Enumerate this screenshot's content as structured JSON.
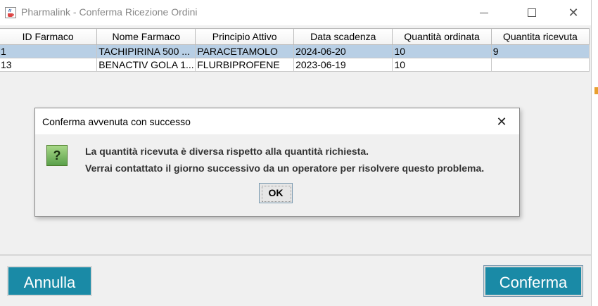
{
  "window": {
    "title": "Pharmalink - Conferma Ricezione Ordini",
    "minimize_glyph": "",
    "close_glyph": "✕"
  },
  "table": {
    "columns": [
      "ID Farmaco",
      "Nome Farmaco",
      "Principio Attivo",
      "Data scadenza",
      "Quantità ordinata",
      "Quantita ricevuta"
    ],
    "rows": [
      {
        "id": "1",
        "nome": "TACHIPIRINA 500 ...",
        "principio": "PARACETAMOLO",
        "scadenza": "2024-06-20",
        "ordinata": "10",
        "ricevuta": "9"
      },
      {
        "id": "13",
        "nome": "BENACTIV GOLA 1...",
        "principio": "FLURBIPROFENE",
        "scadenza": "2023-06-19",
        "ordinata": "10",
        "ricevuta": ""
      }
    ]
  },
  "dialog": {
    "title": "Conferma avvenuta con successo",
    "close_glyph": "✕",
    "icon_glyph": "?",
    "message_line1": "La quantità ricevuta è diversa rispetto alla quantità richiesta.",
    "message_line2": "Verrai contattato il giorno successivo da un operatore per risolvere questo problema.",
    "ok_label": "OK"
  },
  "buttons": {
    "annulla_label": "Annulla",
    "conferma_label": "Conferma"
  },
  "colors": {
    "accent_button": "#1a8aa6",
    "selected_row": "#b8cfe5"
  },
  "icons": {
    "app": "java-cup-icon",
    "dialog": "question-icon"
  }
}
